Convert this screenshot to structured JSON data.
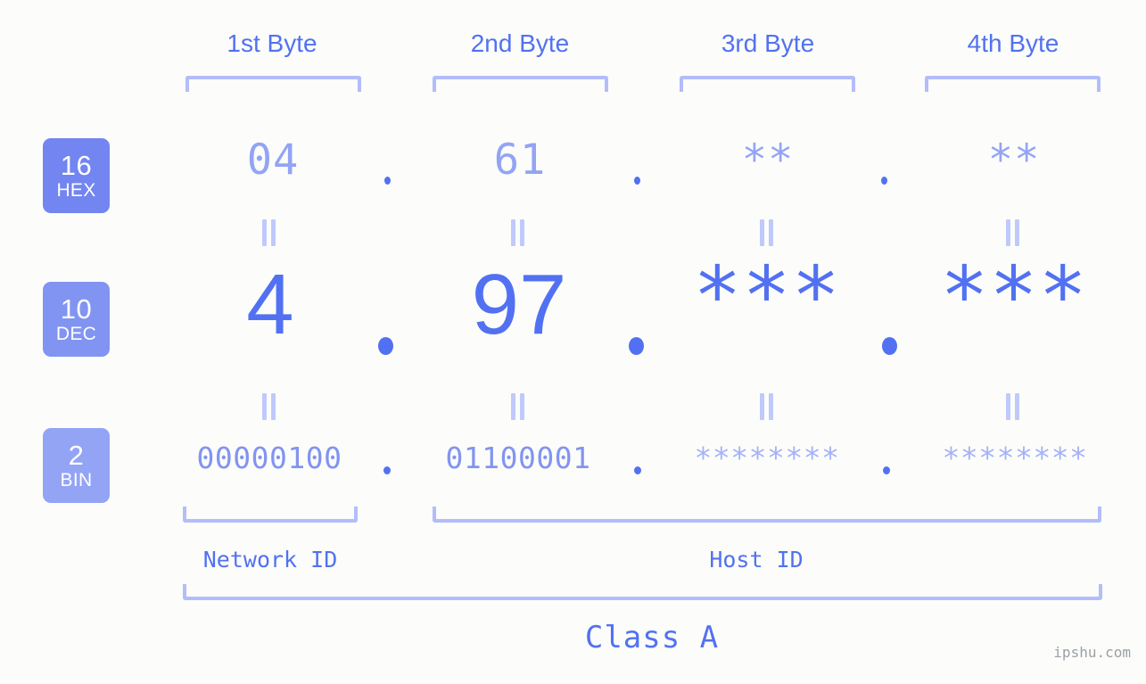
{
  "page": {
    "background_color": "#fcfdfa",
    "accent_color": "#5271f2",
    "accent_light_color": "#93a4f5",
    "bracket_color": "#b3bdfb",
    "watermark": "ipshu.com"
  },
  "byte_headers": [
    {
      "label": "1st Byte"
    },
    {
      "label": "2nd Byte"
    },
    {
      "label": "3rd Byte"
    },
    {
      "label": "4th Byte"
    }
  ],
  "rows": [
    {
      "badge_number": "16",
      "badge_tag": "HEX",
      "badge_color": "#7285f0",
      "values": [
        "04",
        "61",
        "**",
        "**"
      ],
      "separator": "."
    },
    {
      "badge_number": "10",
      "badge_tag": "DEC",
      "badge_color": "#8294f2",
      "values": [
        "4",
        "97",
        "***",
        "***"
      ],
      "separator": "."
    },
    {
      "badge_number": "2",
      "badge_tag": "BIN",
      "badge_color": "#93a4f5",
      "values": [
        "00000100",
        "01100001",
        "********",
        "********"
      ],
      "separator": "."
    }
  ],
  "equivalence_mark": "||",
  "sections": [
    {
      "label": "Network ID"
    },
    {
      "label": "Host ID"
    }
  ],
  "class": {
    "label": "Class A"
  }
}
